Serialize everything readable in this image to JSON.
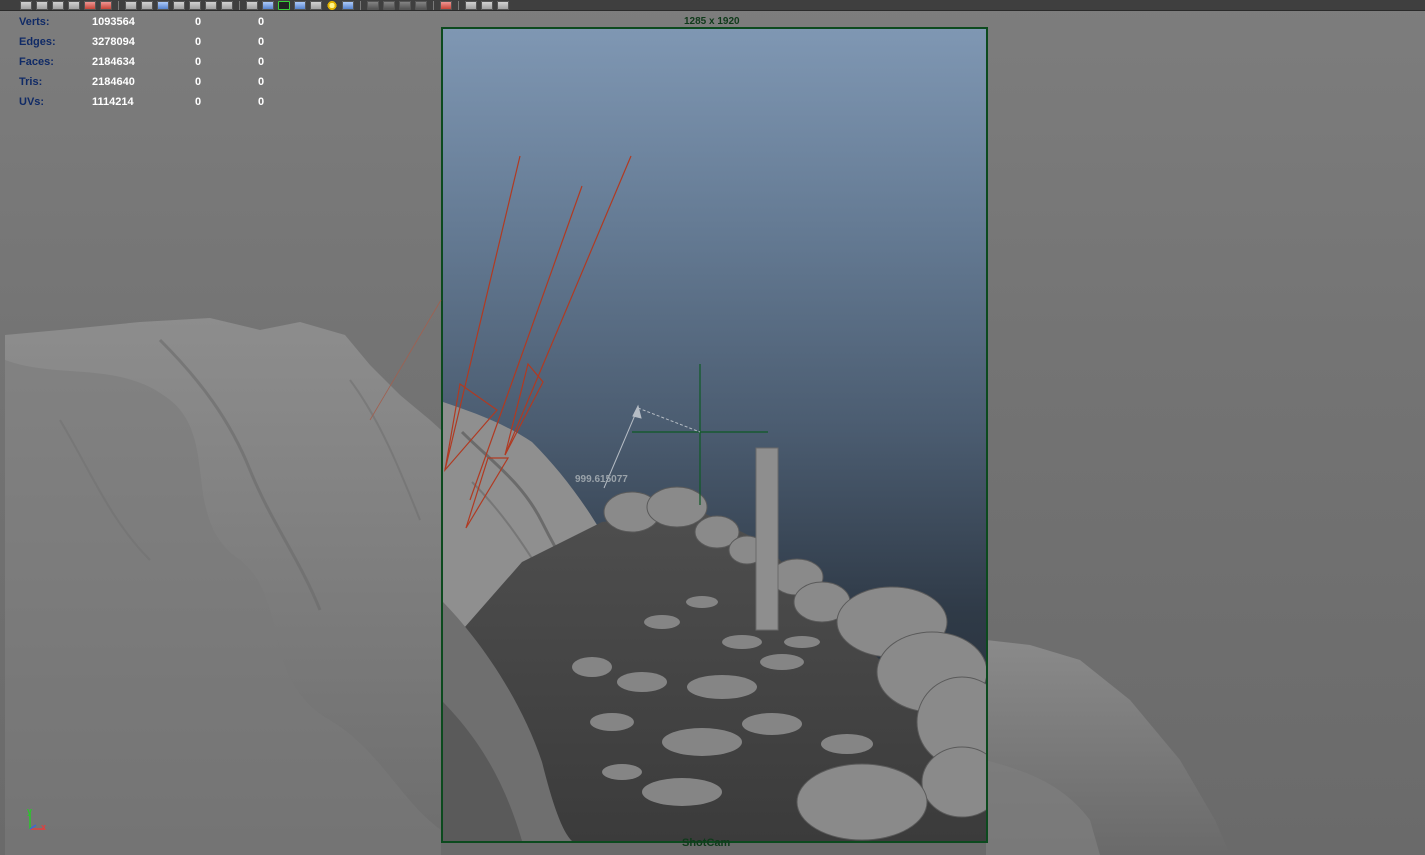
{
  "hud": {
    "rows": [
      {
        "label": "Verts:",
        "v1": "1093564",
        "v2": "0",
        "v3": "0"
      },
      {
        "label": "Edges:",
        "v1": "3278094",
        "v2": "0",
        "v3": "0"
      },
      {
        "label": "Faces:",
        "v1": "2184634",
        "v2": "0",
        "v3": "0"
      },
      {
        "label": "Tris:",
        "v1": "2184640",
        "v2": "0",
        "v3": "0"
      },
      {
        "label": "UVs:",
        "v1": "1114214",
        "v2": "0",
        "v3": "0"
      }
    ]
  },
  "viewport": {
    "resolution": "1285 x 1920",
    "camera": "ShotCam",
    "distance_readout": "999.615077",
    "axis_y": "y",
    "axis_x": "x"
  },
  "colors": {
    "gate_border": "#0c4a1e",
    "hud_label": "#102a66",
    "light_lines": "#b03a22",
    "manipulator": "#0e5a25",
    "rock": "#8c8c8c"
  }
}
